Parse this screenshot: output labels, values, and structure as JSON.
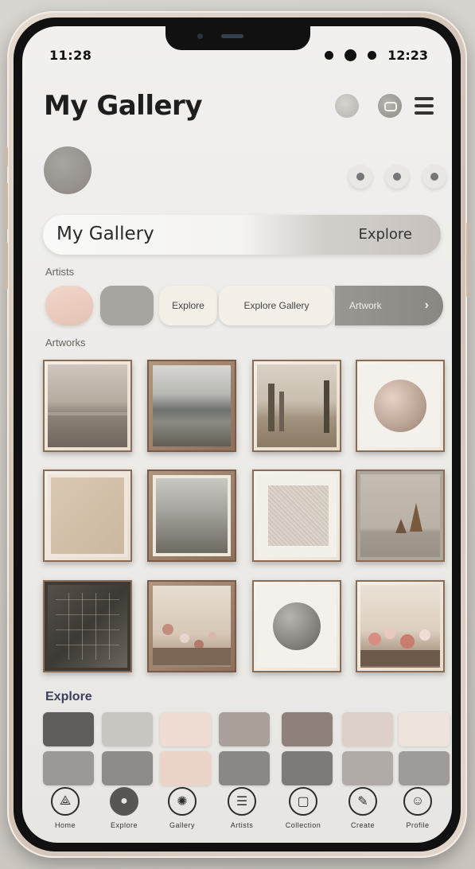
{
  "status_bar": {
    "time": "11:28",
    "right_text": "12:23"
  },
  "header": {
    "title": "My Gallery"
  },
  "profile": {
    "caption": ""
  },
  "search": {
    "left_label": "My Gallery",
    "right_label": "Explore"
  },
  "filters": {
    "label": "Artists",
    "chips": [
      {
        "label": ""
      },
      {
        "label": ""
      },
      {
        "label": "Explore"
      },
      {
        "label": "Explore  Gallery"
      },
      {
        "label": "Artwork",
        "icon": "chevron-right-icon"
      }
    ]
  },
  "artworks": {
    "label": "Artworks",
    "items": [
      {
        "subject": "misty-landscape"
      },
      {
        "subject": "foggy-lake"
      },
      {
        "subject": "trees-by-water"
      },
      {
        "subject": "pink-sphere"
      },
      {
        "subject": "beige-canvas"
      },
      {
        "subject": "cloudy-sky"
      },
      {
        "subject": "linen-texture"
      },
      {
        "subject": "ship-on-sea"
      },
      {
        "subject": "glass-architecture"
      },
      {
        "subject": "flower-still-life"
      },
      {
        "subject": "gray-sphere"
      },
      {
        "subject": "floral-arrangement"
      }
    ]
  },
  "explore": {
    "label": "Explore",
    "swatches": [
      "#5e5d5b",
      "#c9c6c2",
      "#efdcd2",
      "#a9a09a",
      "#8f8079",
      "#ddd0c8",
      "#eee4dd",
      "#9b9895",
      "#8e8b88",
      "#ecd5c8",
      "#8a8886",
      "#7d7b79",
      "#b0aba7",
      "#9e9b98"
    ]
  },
  "nav": {
    "items": [
      {
        "label": "Home",
        "icon": "easel-icon"
      },
      {
        "label": "Explore",
        "icon": "discover-icon"
      },
      {
        "label": "Gallery",
        "icon": "palette-icon"
      },
      {
        "label": "Artists",
        "icon": "art-icon"
      },
      {
        "label": "Collection",
        "icon": "frame-icon"
      },
      {
        "label": "Create",
        "icon": "brush-icon"
      },
      {
        "label": "Profile",
        "icon": "profile-icon"
      }
    ]
  }
}
